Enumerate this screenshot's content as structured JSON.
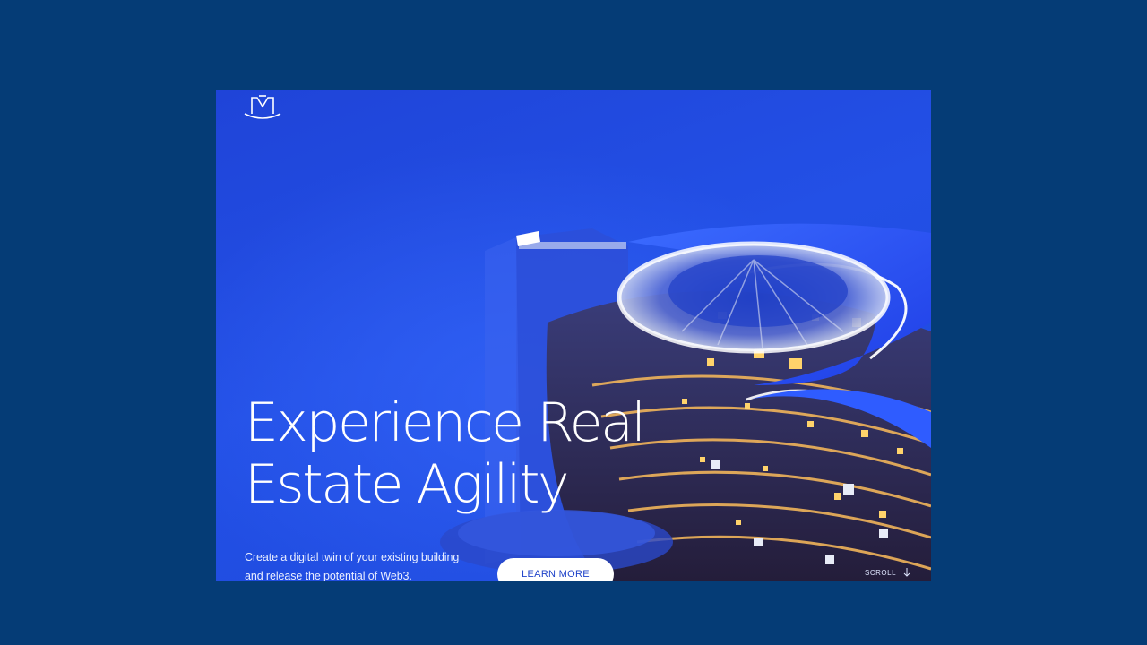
{
  "hero": {
    "headline_line1": "Experience Real",
    "headline_line2": "Estate Agility",
    "subtext_line1": "Create a digital twin of your existing building",
    "subtext_line2": "and release the potential of Web3.",
    "cta_label": "LEARN MORE",
    "scroll_label": "SCROLL"
  },
  "logo": {
    "icon": "crown-m-logo"
  },
  "icons": {
    "scroll": "arrow-down-icon"
  },
  "colors": {
    "page_background": "#053c76",
    "hero_background": "#2350e6",
    "text": "#ffffff",
    "button_text": "#2043c9"
  }
}
